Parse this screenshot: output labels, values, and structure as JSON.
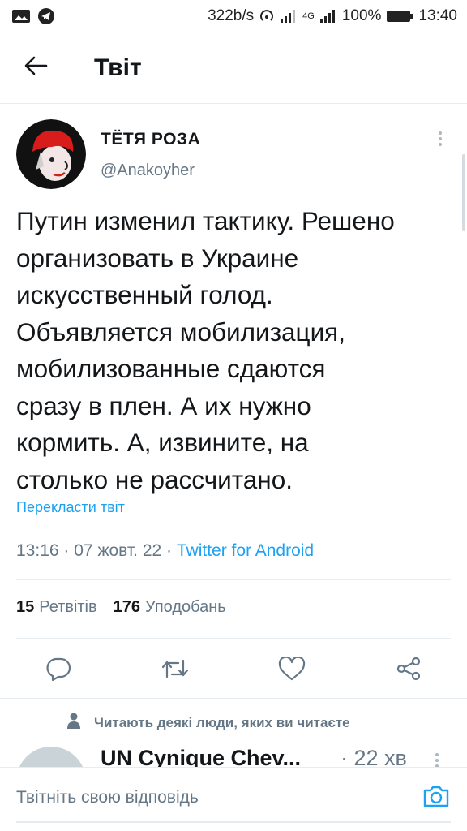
{
  "status_bar": {
    "speed": "322b/s",
    "network": "4G",
    "battery": "100%",
    "time": "13:40",
    "icons": [
      "image-icon",
      "telegram-icon",
      "wifi-hotspot-icon",
      "signal-icon",
      "signal-4g-icon",
      "battery-icon"
    ]
  },
  "header": {
    "title": "Твіт",
    "back_icon": "arrow-left-icon"
  },
  "tweet": {
    "author_name": "ТЁТЯ РОЗА",
    "author_handle": "@Anakoyher",
    "text": "Путин изменил тактику. Решено\nорганизовать в Украине\nискусственный голод.\nОбъявляется мобилизация,\nмобилизованные сдаются\nсразу в плен. А их нужно\nкормить. А, извините, на\nстолько не рассчитано.",
    "translate_label": "Перекласти твіт",
    "time": "13:16",
    "date": "07 жовт. 22",
    "separator": "·",
    "client": "Twitter for Android",
    "retweets_count": "15",
    "retweets_label": "Ретвітів",
    "likes_count": "176",
    "likes_label": "Уподобань",
    "actions": [
      "reply-icon",
      "retweet-icon",
      "like-icon",
      "share-icon"
    ]
  },
  "social_context": {
    "text": "Читають деякі люди, яких ви читаєте",
    "icon": "person-icon"
  },
  "reply_preview": {
    "name": "UN Cynique Chev...",
    "time": "· 22 хв"
  },
  "compose": {
    "placeholder": "Твітніть свою відповідь",
    "icon": "camera-icon"
  },
  "colors": {
    "accent": "#1da1f2",
    "secondary_text": "#657786",
    "primary_text": "#14171a",
    "divider": "#e6ecf0"
  }
}
